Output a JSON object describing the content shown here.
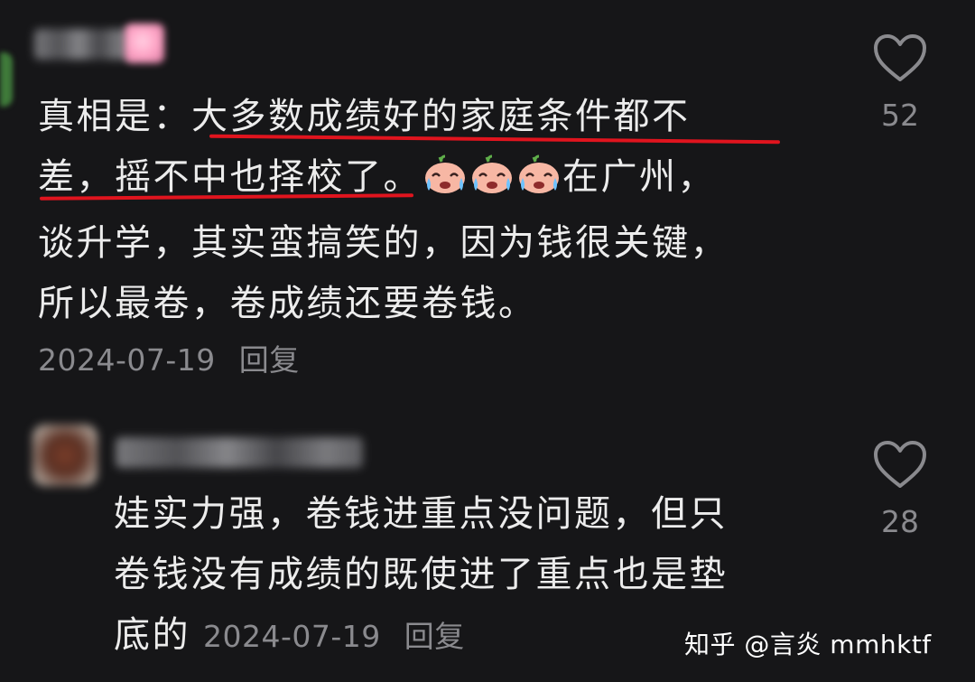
{
  "comments": [
    {
      "text_prefix": "真相是：",
      "text_highlight_a": "大多数成绩好的家庭条件都不",
      "text_highlight_b": "差，摇不中也择校了。",
      "text_suffix_line2": "在广州，",
      "text_line3": "谈升学，其实蛮搞笑的，因为钱很关键，",
      "text_line4": "所以最卷，卷成绩还要卷钱。",
      "emojis": [
        "crying-face-emoji",
        "crying-face-emoji",
        "crying-face-emoji"
      ],
      "date": "2024-07-19",
      "reply_label": "回复",
      "like_count": "52",
      "highlight_color": "#e0141e"
    },
    {
      "text_line1": "娃实力强，卷钱进重点没问题，但只",
      "text_line2": "卷钱没有成绩的既使进了重点也是垫",
      "text_line3": "底的",
      "date": "2024-07-19",
      "reply_label": "回复",
      "like_count": "28"
    }
  ],
  "watermark": "知乎 @言炎 mmhktf"
}
